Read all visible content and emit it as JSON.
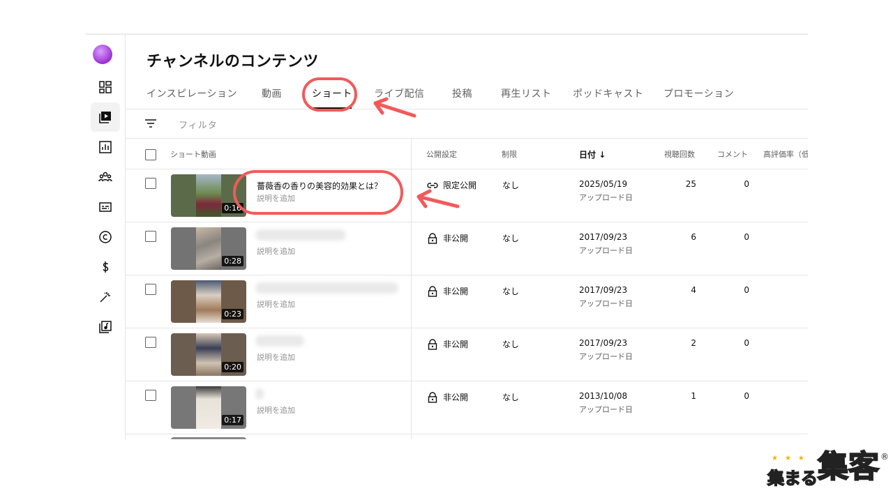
{
  "page_title": "チャンネルのコンテンツ",
  "tabs": [
    {
      "label": "インスピレーション"
    },
    {
      "label": "動画"
    },
    {
      "label": "ショート"
    },
    {
      "label": "ライブ配信"
    },
    {
      "label": "投稿"
    },
    {
      "label": "再生リスト"
    },
    {
      "label": "ポッドキャスト"
    },
    {
      "label": "プロモーション"
    }
  ],
  "active_tab": "ショート",
  "filter": {
    "placeholder": "フィルタ"
  },
  "columns": {
    "video": "ショート動画",
    "visibility": "公開設定",
    "restriction": "制限",
    "date": "日付",
    "views": "視聴回数",
    "comments": "コメント",
    "likes": "高評価率（低"
  },
  "rows": [
    {
      "duration": "0:16",
      "title": "薔薇香の香りの美容的効果とは？",
      "desc": "説明を追加",
      "visibility": "限定公開",
      "visibility_icon": "link-icon",
      "restriction": "なし",
      "date": "2025/05/19",
      "date_sub": "アップロード日",
      "views": "25",
      "comments": "0"
    },
    {
      "duration": "0:28",
      "title": "",
      "desc": "説明を追加",
      "visibility": "非公開",
      "visibility_icon": "lock-icon",
      "restriction": "なし",
      "date": "2017/09/23",
      "date_sub": "アップロード日",
      "views": "6",
      "comments": "0"
    },
    {
      "duration": "0:23",
      "title": "",
      "desc": "説明を追加",
      "visibility": "非公開",
      "visibility_icon": "lock-icon",
      "restriction": "なし",
      "date": "2017/09/23",
      "date_sub": "アップロード日",
      "views": "4",
      "comments": "0"
    },
    {
      "duration": "0:20",
      "title": "",
      "desc": "説明を追加",
      "visibility": "非公開",
      "visibility_icon": "lock-icon",
      "restriction": "なし",
      "date": "2017/09/23",
      "date_sub": "アップロード日",
      "views": "2",
      "comments": "0"
    },
    {
      "duration": "0:17",
      "title": "",
      "desc": "説明を追加",
      "visibility": "非公開",
      "visibility_icon": "lock-icon",
      "restriction": "なし",
      "date": "2013/10/08",
      "date_sub": "アップロード日",
      "views": "1",
      "comments": "0"
    }
  ],
  "sidebar_icons": [
    "dashboard-icon",
    "content-icon",
    "analytics-icon",
    "community-icon",
    "subtitles-icon",
    "copyright-icon",
    "earn-icon",
    "customization-icon",
    "audio-library-icon"
  ],
  "logo": {
    "small": "集まる",
    "big": "集客",
    "reg": "®"
  },
  "colors": {
    "highlight": "#f25a5a",
    "logo_pink": "#ff4fa3",
    "logo_yellow": "#ffd700"
  }
}
